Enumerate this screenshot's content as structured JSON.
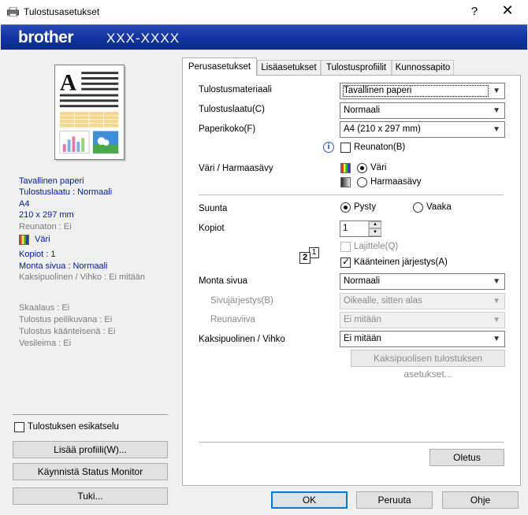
{
  "window": {
    "title": "Tulostusasetukset",
    "help": "?",
    "close": "✕"
  },
  "banner": {
    "logo": "brother",
    "model": "XXX-XXXX"
  },
  "summary": {
    "media": "Tavallinen paperi",
    "quality": "Tulostuslaatu : Normaali",
    "size": "A4",
    "dimensions": "210 x 297 mm",
    "borderless": "Reunaton : Ei",
    "color": "Väri",
    "copies": "Kopiot : 1",
    "multipage": "Monta sivua : Normaali",
    "duplex": "Kaksipuolinen / Vihko : Ei mitään",
    "scaling": "Skaalaus : Ei",
    "mirror": "Tulostus peilikuvana : Ei",
    "reverse": "Tulostus käänteisenä : Ei",
    "watermark": "Vesileima : Ei"
  },
  "left": {
    "preview_label": "Tulostuksen esikatselu",
    "add_profile": "Lisää profiili(W)...",
    "status_monitor": "Käynnistä Status Monitor",
    "support": "Tuki..."
  },
  "tabs": [
    "Perusasetukset",
    "Lisäasetukset",
    "Tulostusprofiilit",
    "Kunnossapito"
  ],
  "basic": {
    "media_label": "Tulostusmateriaali",
    "media_value": "Tavallinen paperi",
    "quality_label": "Tulostuslaatu(C)",
    "quality_value": "Normaali",
    "size_label": "Paperikoko(F)",
    "size_value": "A4 (210 x 297 mm)",
    "borderless_label": "Reunaton(B)",
    "color_label": "Väri / Harmaasävy",
    "color_option": "Väri",
    "gray_option": "Harmaasävy",
    "orientation_label": "Suunta",
    "portrait": "Pysty",
    "landscape": "Vaaka",
    "copies_label": "Kopiot",
    "copies_value": "1",
    "collate_label": "Lajittele(Q)",
    "reverse_label": "Käänteinen järjestys(A)",
    "multipage_label": "Monta sivua",
    "multipage_value": "Normaali",
    "page_order_label": "Sivujärjestys(B)",
    "page_order_value": "Oikealle, sitten alas",
    "border_label": "Reunaviiva",
    "border_value": "Ei mitään",
    "duplex_label": "Kaksipuolinen / Vihko",
    "duplex_value": "Ei mitään",
    "duplex_settings": "Kaksipuolisen tulostuksen asetukset...",
    "default_button": "Oletus"
  },
  "footer": {
    "ok": "OK",
    "cancel": "Peruuta",
    "help": "Ohje"
  },
  "colors": {
    "banner": "#1233a0",
    "accent": "#0078d7",
    "summary_text": "#0019a8"
  }
}
